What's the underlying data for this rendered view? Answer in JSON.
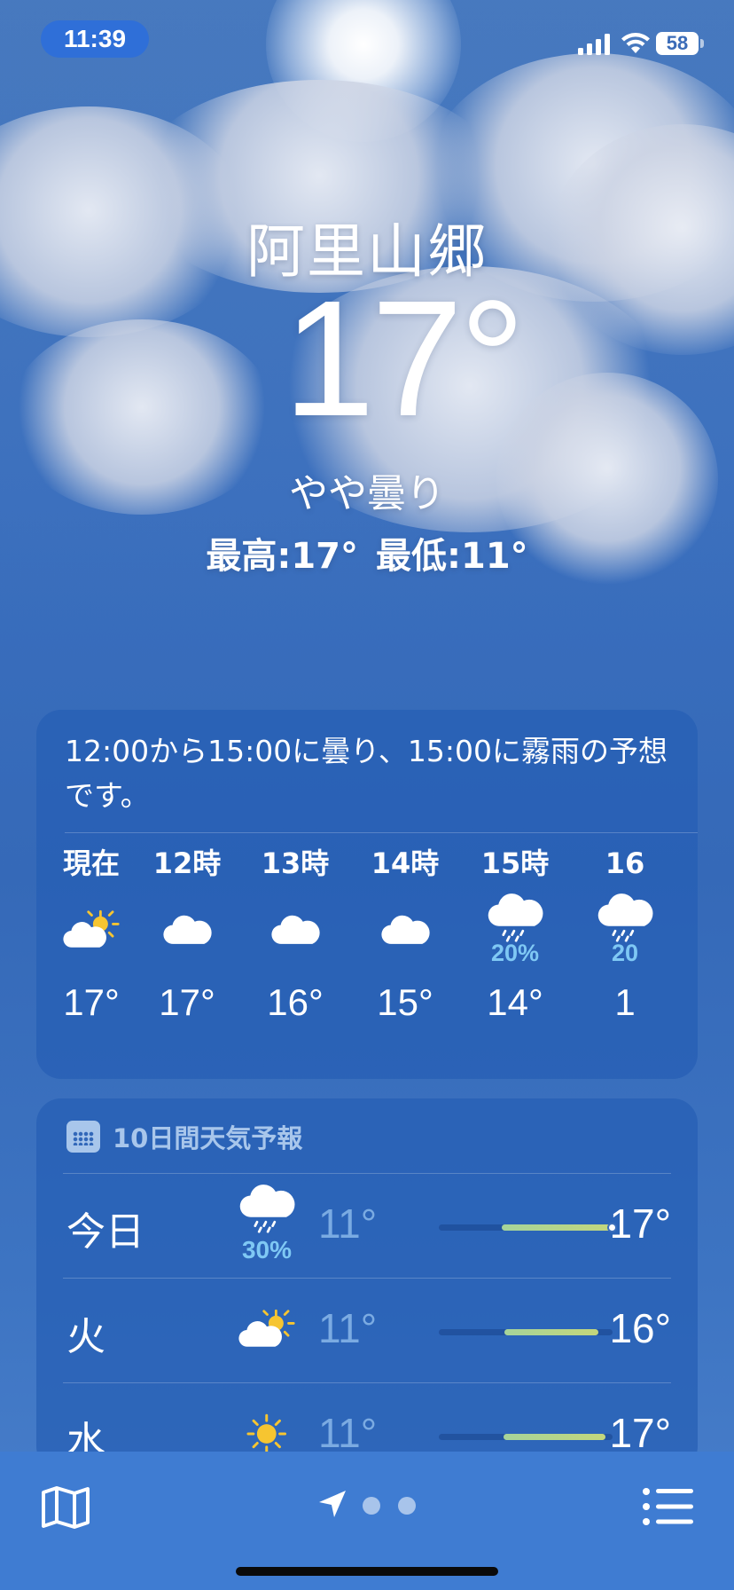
{
  "status_bar": {
    "time": "11:39",
    "battery": "58",
    "icons": [
      "signal-icon",
      "wifi-icon",
      "battery-icon"
    ]
  },
  "header": {
    "city": "阿里山郷",
    "temperature": "17°",
    "condition": "やや曇り",
    "high": "最高:17°",
    "low": "最低:11°"
  },
  "hourly": {
    "summary": "12:00から15:00に曇り、15:00に霧雨の予想です。",
    "items": [
      {
        "label": "現在",
        "icon": "partly-sunny-icon",
        "pop": "",
        "temp": "17°"
      },
      {
        "label": "12時",
        "icon": "cloud-icon",
        "pop": "",
        "temp": "17°"
      },
      {
        "label": "13時",
        "icon": "cloud-icon",
        "pop": "",
        "temp": "16°"
      },
      {
        "label": "14時",
        "icon": "cloud-icon",
        "pop": "",
        "temp": "15°"
      },
      {
        "label": "15時",
        "icon": "drizzle-icon",
        "pop": "20%",
        "temp": "14°"
      },
      {
        "label": "16",
        "icon": "drizzle-icon",
        "pop": "20",
        "temp": "1"
      }
    ]
  },
  "daily": {
    "header": "10日間天気予報",
    "items": [
      {
        "day": "今日",
        "icon": "drizzle-icon",
        "pop": "30%",
        "low": "11°",
        "high": "17°",
        "bar_start": 0.36,
        "bar_end": 1.0,
        "current": 1.0
      },
      {
        "day": "火",
        "icon": "partly-sunny-icon",
        "pop": "",
        "low": "11°",
        "high": "16°",
        "bar_start": 0.38,
        "bar_end": 0.92
      },
      {
        "day": "水",
        "icon": "sun-icon",
        "pop": "",
        "low": "11°",
        "high": "17°",
        "bar_start": 0.37,
        "bar_end": 0.96
      }
    ]
  },
  "toolbar": {
    "page_count": 3,
    "icons": [
      "map-icon",
      "location-arrow-icon",
      "list-icon"
    ]
  },
  "colors": {
    "accent_pop": "#7fc8f4",
    "sun": "#f6c531",
    "bar_fill": "#b8d68a"
  }
}
